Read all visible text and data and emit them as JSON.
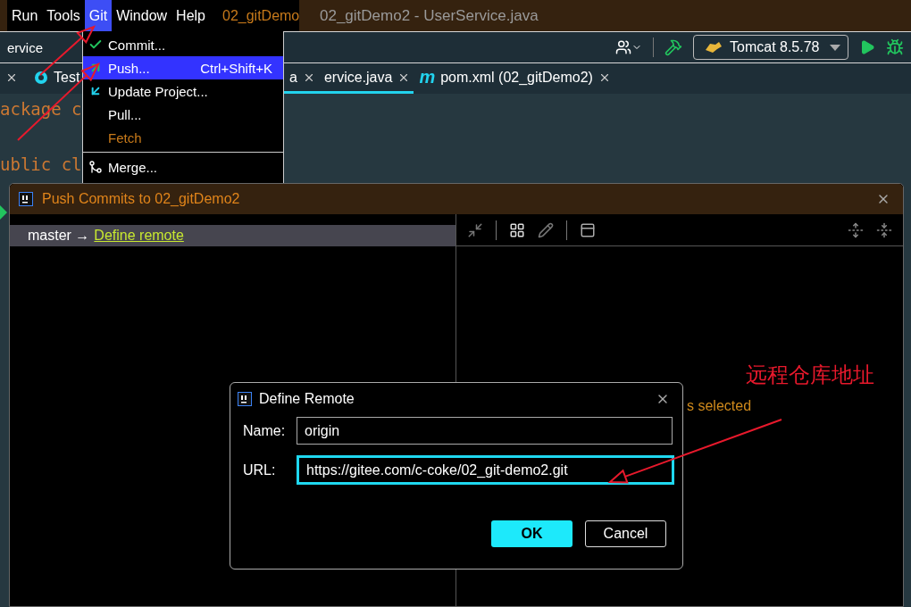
{
  "window": {
    "title": "02_gitDemo2 - UserService.java"
  },
  "menu_bar": {
    "items": [
      {
        "label": "Run",
        "selected": false
      },
      {
        "label": "Tools",
        "selected": false
      },
      {
        "label": "Git",
        "selected": true
      },
      {
        "label": "Window",
        "selected": false
      },
      {
        "label": "Help",
        "selected": false
      }
    ],
    "project": "02_gitDemo"
  },
  "git_menu": {
    "items": [
      {
        "kind": "check",
        "label": "Commit...",
        "selected": false,
        "disabled": false
      },
      {
        "kind": "push",
        "label": "Push...",
        "shortcut": "Ctrl+Shift+K",
        "selected": true,
        "disabled": false
      },
      {
        "kind": "update",
        "label": "Update Project...",
        "selected": false,
        "disabled": false
      },
      {
        "kind": "plain",
        "label": "Pull...",
        "selected": false,
        "disabled": false
      },
      {
        "kind": "plain",
        "label": "Fetch",
        "selected": false,
        "disabled": true
      },
      {
        "kind": "separator"
      },
      {
        "kind": "merge",
        "label": "Merge...",
        "selected": false,
        "disabled": false
      }
    ]
  },
  "toolbar": {
    "breadcrumb": "ervice",
    "run_config": "Tomcat 8.5.78"
  },
  "tabs": [
    {
      "kind": "close_only",
      "selected": false
    },
    {
      "kind": "class",
      "label": "Test",
      "selected": false
    },
    {
      "kind": "plain",
      "label": "a",
      "selected": true
    },
    {
      "kind": "plain",
      "label": "ervice.java",
      "selected": true
    },
    {
      "kind": "maven",
      "badge": "m",
      "label": "pom.xml (02_gitDemo2)",
      "selected": false
    }
  ],
  "editor": {
    "lines": [
      "ackage c",
      "ublic cl"
    ]
  },
  "push_dialog": {
    "title": "Push Commits to 02_gitDemo2",
    "branch": {
      "name": "master",
      "arrow": "→",
      "link": "Define remote"
    },
    "status": "s selected"
  },
  "define_remote": {
    "title": "Define Remote",
    "fields": [
      {
        "label": "Name:",
        "value": "origin",
        "focused": false
      },
      {
        "label": "URL:",
        "value": "https://gitee.com/c-coke/02_git-demo2.git",
        "focused": true
      }
    ],
    "buttons": [
      {
        "label": "OK",
        "kind": "primary"
      },
      {
        "label": "Cancel",
        "kind": "secondary"
      }
    ]
  },
  "annotation": {
    "text": "远程仓库地址"
  }
}
